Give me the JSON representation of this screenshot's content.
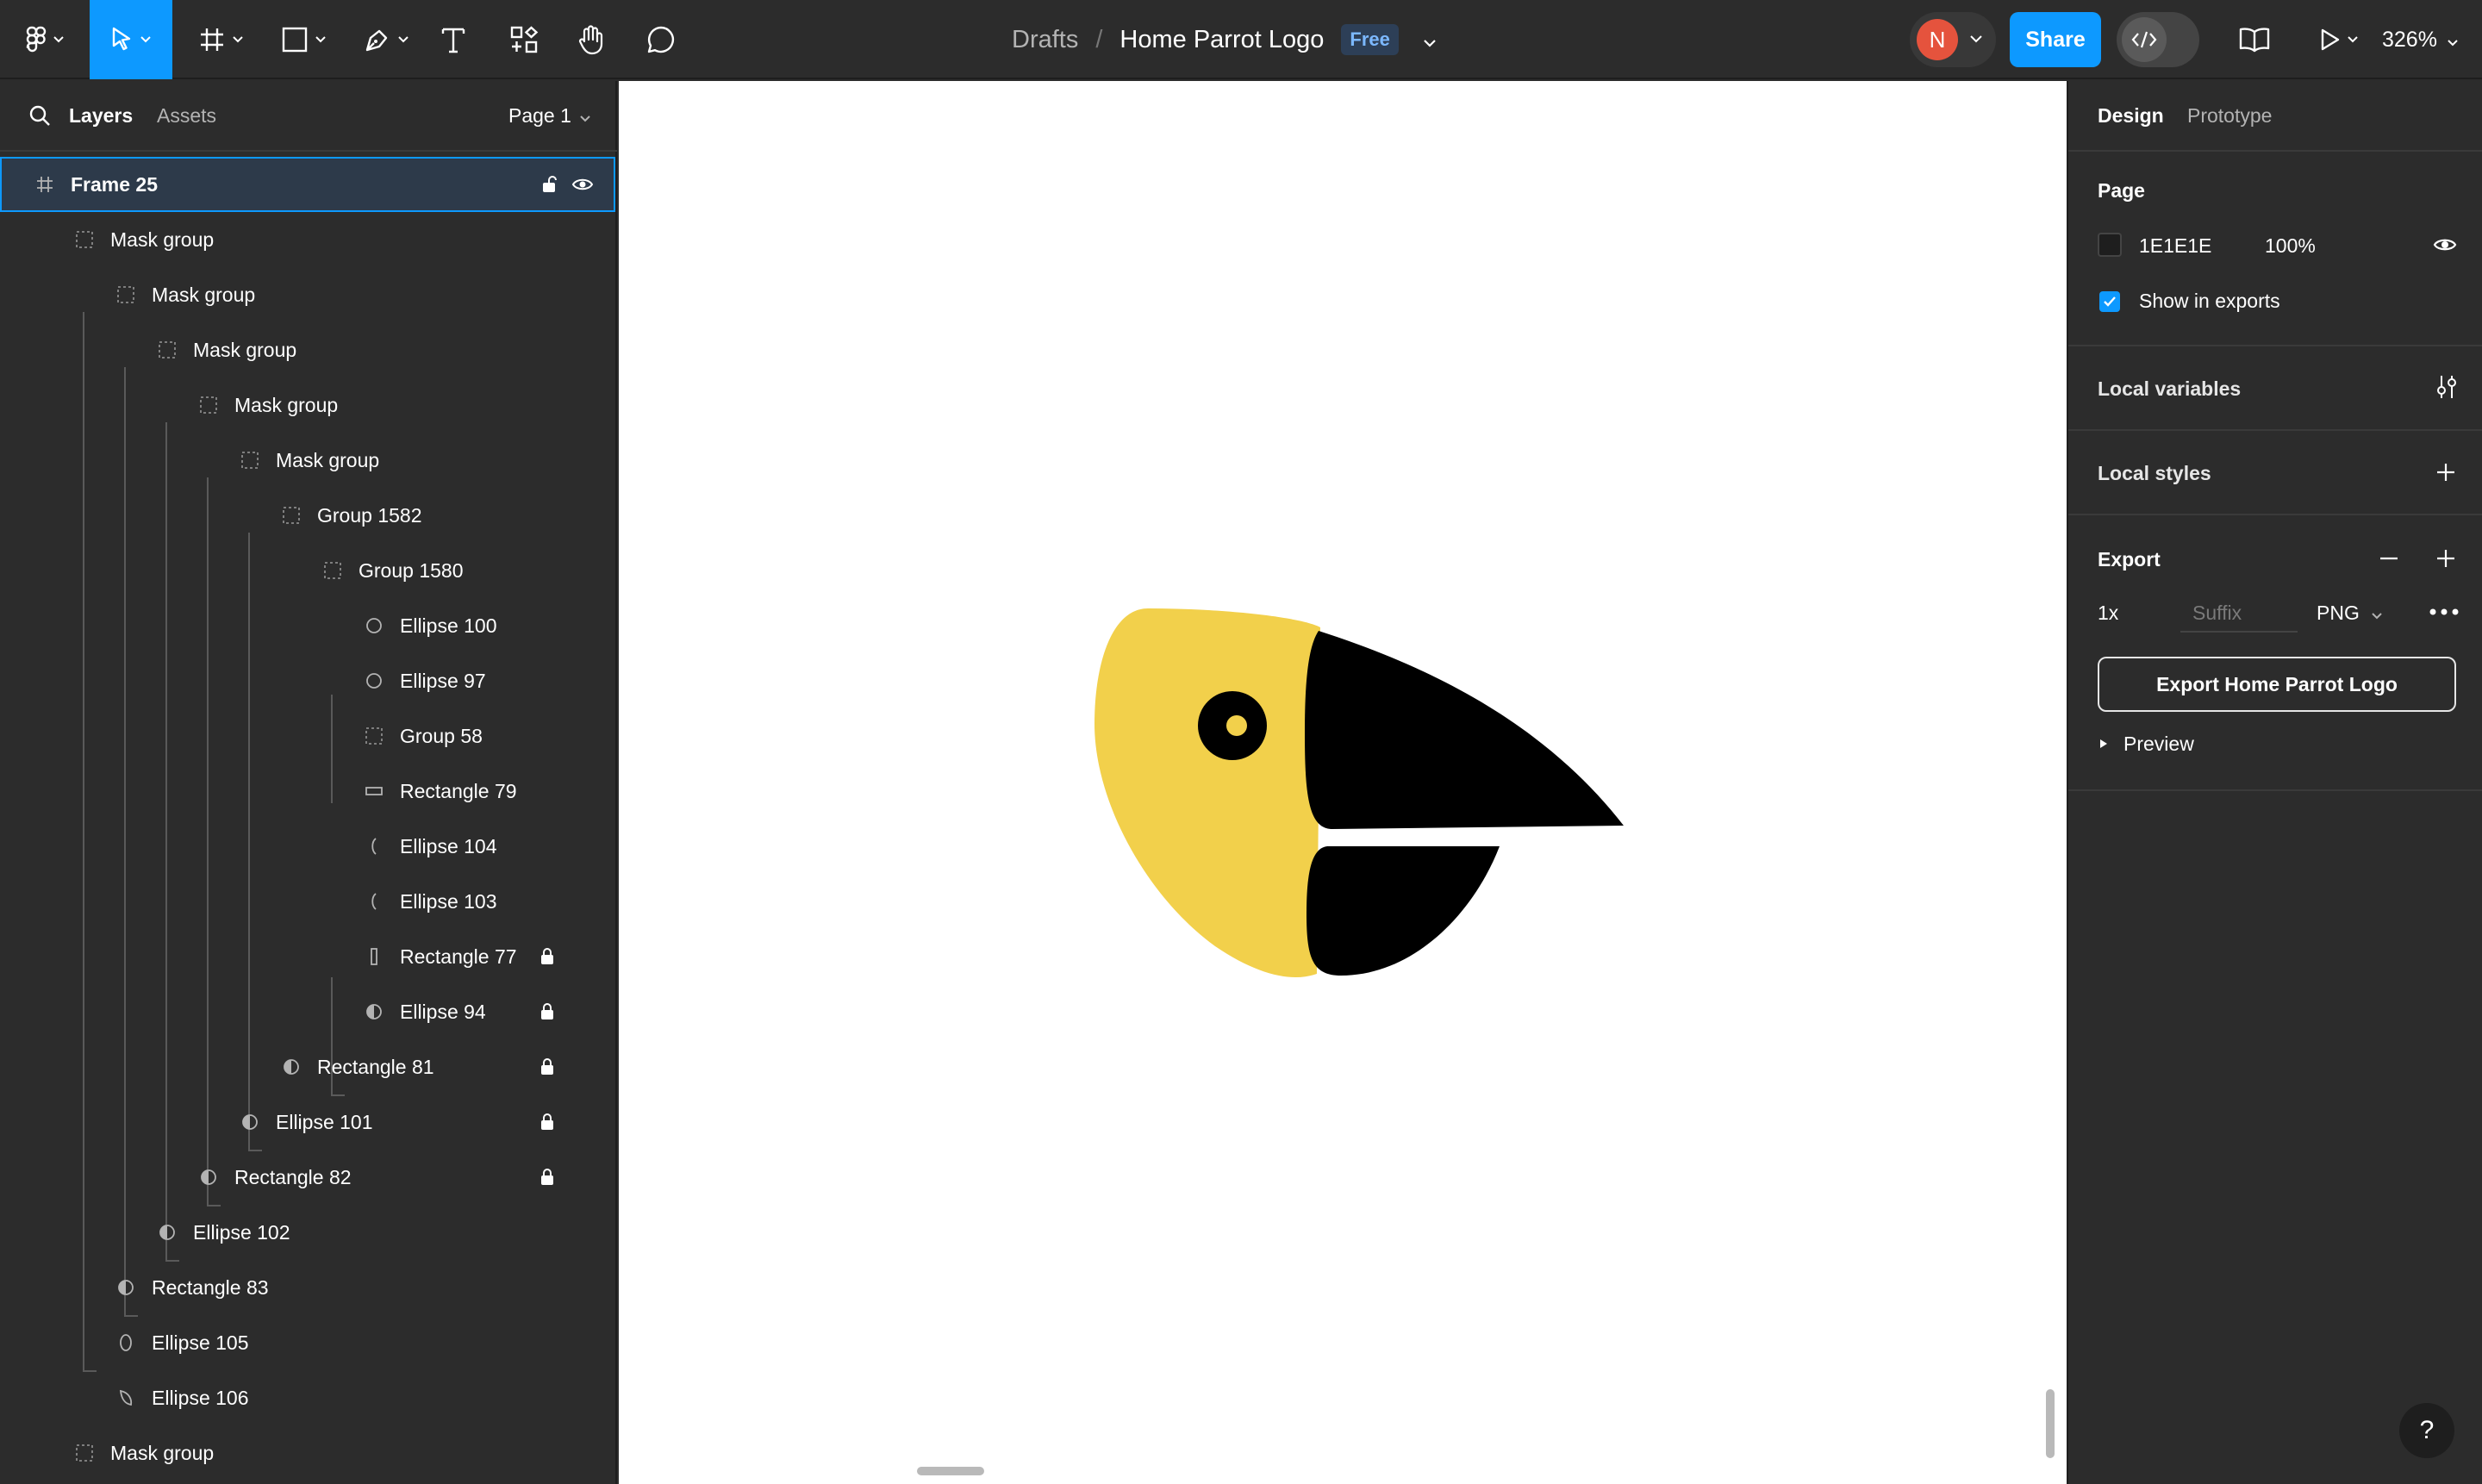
{
  "toolbar": {
    "tools": [
      {
        "name": "main-menu",
        "icon": "figma-logo-icon"
      },
      {
        "name": "move",
        "icon": "move-cursor-icon",
        "active": true
      },
      {
        "name": "frame",
        "icon": "frame-hash-icon"
      },
      {
        "name": "shape",
        "icon": "rectangle-icon"
      },
      {
        "name": "pen",
        "icon": "pen-icon"
      },
      {
        "name": "text",
        "icon": "text-icon"
      },
      {
        "name": "resources",
        "icon": "components-icon"
      },
      {
        "name": "hand",
        "icon": "hand-icon"
      },
      {
        "name": "comment",
        "icon": "comment-icon"
      }
    ],
    "breadcrumb_drafts": "Drafts",
    "breadcrumb_separator": "/",
    "file_title": "Home Parrot Logo",
    "plan_badge": "Free",
    "avatar_initial": "N",
    "share_label": "Share",
    "zoom_label": "326%"
  },
  "left_panel": {
    "tab_layers": "Layers",
    "tab_assets": "Assets",
    "page_select": "Page 1",
    "layers": [
      {
        "label": "Frame 25",
        "depth": 0,
        "icon": "frame",
        "selected": true
      },
      {
        "label": "Mask group",
        "depth": 1,
        "icon": "group"
      },
      {
        "label": "Mask group",
        "depth": 2,
        "icon": "group"
      },
      {
        "label": "Mask group",
        "depth": 3,
        "icon": "group"
      },
      {
        "label": "Mask group",
        "depth": 4,
        "icon": "group"
      },
      {
        "label": "Mask group",
        "depth": 5,
        "icon": "group"
      },
      {
        "label": "Group 1582",
        "depth": 6,
        "icon": "group"
      },
      {
        "label": "Group 1580",
        "depth": 7,
        "icon": "group"
      },
      {
        "label": "Ellipse 100",
        "depth": 8,
        "icon": "ellipse"
      },
      {
        "label": "Ellipse 97",
        "depth": 8,
        "icon": "ellipse"
      },
      {
        "label": "Group 58",
        "depth": 8,
        "icon": "group"
      },
      {
        "label": "Rectangle 79",
        "depth": 8,
        "icon": "rect-h"
      },
      {
        "label": "Ellipse 104",
        "depth": 8,
        "icon": "arc"
      },
      {
        "label": "Ellipse 103",
        "depth": 8,
        "icon": "arc"
      },
      {
        "label": "Rectangle 77",
        "depth": 8,
        "icon": "rect-v",
        "locked": true
      },
      {
        "label": "Ellipse 94",
        "depth": 8,
        "icon": "mask",
        "locked": true
      },
      {
        "label": "Rectangle 81",
        "depth": 6,
        "icon": "mask",
        "locked": true
      },
      {
        "label": "Ellipse 101",
        "depth": 5,
        "icon": "mask",
        "locked": true
      },
      {
        "label": "Rectangle 82",
        "depth": 4,
        "icon": "mask",
        "locked": true
      },
      {
        "label": "Ellipse 102",
        "depth": 3,
        "icon": "mask"
      },
      {
        "label": "Rectangle 83",
        "depth": 2,
        "icon": "mask"
      },
      {
        "label": "Ellipse 105",
        "depth": 2,
        "icon": "ellipse-v"
      },
      {
        "label": "Ellipse 106",
        "depth": 2,
        "icon": "leaf"
      },
      {
        "label": "Mask group",
        "depth": 1,
        "icon": "group"
      }
    ]
  },
  "canvas": {
    "background": "#FFFFFF",
    "logo_colors": {
      "head": "#F2D04B",
      "beak": "#000000",
      "pupil": "#F2D04B"
    }
  },
  "right_panel": {
    "tab_design": "Design",
    "tab_prototype": "Prototype",
    "page_section_title": "Page",
    "page_color_hex": "1E1E1E",
    "page_color_opacity": "100%",
    "show_in_exports_label": "Show in exports",
    "local_variables_label": "Local variables",
    "local_styles_label": "Local styles",
    "export_section_title": "Export",
    "export_scale": "1x",
    "export_suffix_placeholder": "Suffix",
    "export_format": "PNG",
    "export_button_label": "Export Home Parrot Logo",
    "preview_label": "Preview"
  },
  "help_label": "?"
}
